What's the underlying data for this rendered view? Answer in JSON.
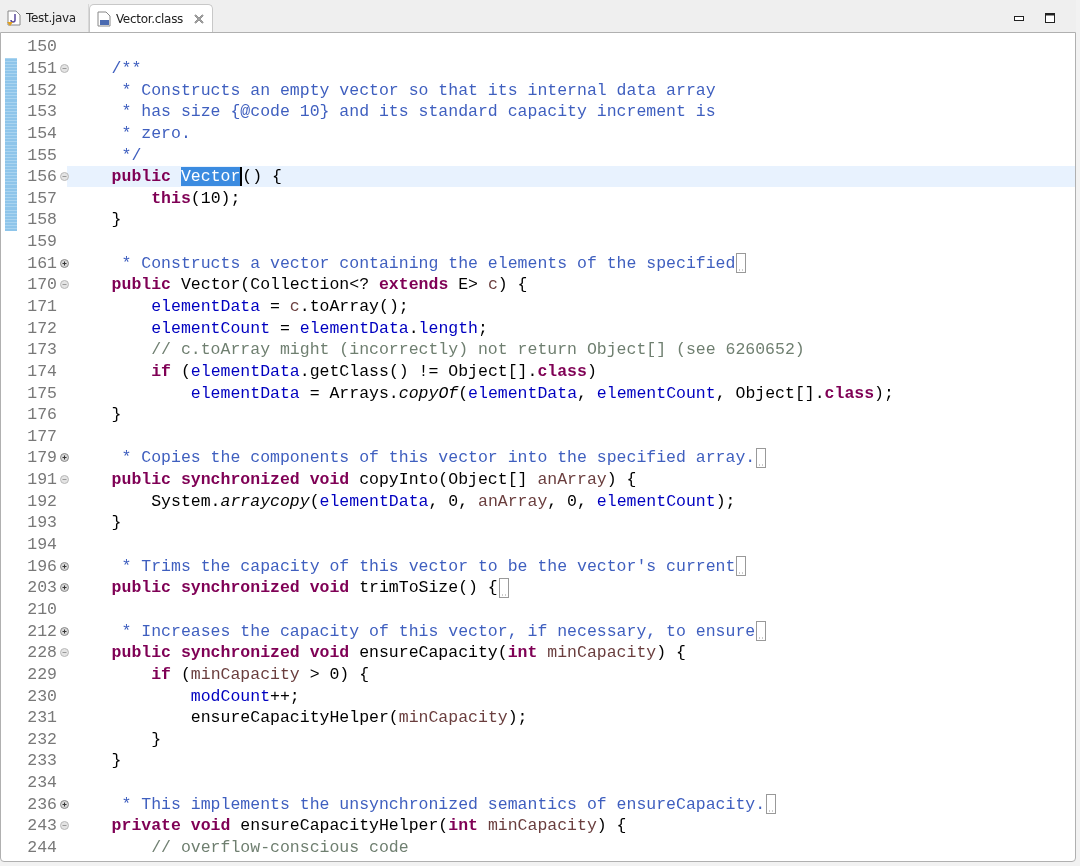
{
  "tabs": [
    {
      "label": "Test.java",
      "kind": "java",
      "selected": false
    },
    {
      "label": "Vector.class",
      "kind": "class",
      "selected": true
    }
  ],
  "lines": [
    {
      "number": "150",
      "changed": false,
      "current": false
    },
    {
      "number": "151",
      "folded": false,
      "changed": true,
      "current": false,
      "tokens": [
        {
          "kind": "javadoc",
          "text": "    /**"
        }
      ]
    },
    {
      "number": "152",
      "changed": true,
      "current": false,
      "tokens": [
        {
          "kind": "javadoc",
          "text": "     * Constructs an empty vector so that its internal data array"
        }
      ]
    },
    {
      "number": "153",
      "changed": true,
      "current": false,
      "tokens": [
        {
          "kind": "javadoc",
          "text": "     * has size {@code 10} and its standard capacity increment is"
        }
      ]
    },
    {
      "number": "154",
      "changed": true,
      "current": false,
      "tokens": [
        {
          "kind": "javadoc",
          "text": "     * zero."
        }
      ]
    },
    {
      "number": "155",
      "changed": true,
      "current": false,
      "tokens": [
        {
          "kind": "javadoc",
          "text": "     */"
        }
      ]
    },
    {
      "number": "156",
      "folded": false,
      "changed": true,
      "current": true,
      "tokens": [
        {
          "kind": "keyword",
          "text": "    public "
        },
        {
          "kind": "selected",
          "text": "Vector"
        },
        {
          "kind": "plain",
          "text": "() {"
        }
      ]
    },
    {
      "number": "157",
      "changed": true,
      "current": false,
      "tokens": [
        {
          "kind": "keyword",
          "text": "        this"
        },
        {
          "kind": "plain",
          "text": "(10);"
        }
      ]
    },
    {
      "number": "158",
      "changed": true,
      "current": false,
      "tokens": [
        {
          "kind": "plain",
          "text": "    }"
        }
      ]
    },
    {
      "number": "159",
      "changed": false,
      "current": false
    },
    {
      "number": "161",
      "folded": true,
      "changed": false,
      "current": false,
      "tokens": [
        {
          "kind": "javadoc",
          "text": "     * Constructs a vector containing the elements of the specified"
        }
      ]
    },
    {
      "number": "170",
      "folded": false,
      "changed": false,
      "current": false,
      "tokens": [
        {
          "kind": "keyword",
          "text": "    public"
        },
        {
          "kind": "plain",
          "text": " Vector(Collection<? "
        },
        {
          "kind": "keyword",
          "text": "extends"
        },
        {
          "kind": "plain",
          "text": " E> "
        },
        {
          "kind": "param",
          "text": "c"
        },
        {
          "kind": "plain",
          "text": ") {"
        }
      ]
    },
    {
      "number": "171",
      "changed": false,
      "current": false,
      "tokens": [
        {
          "kind": "field",
          "text": "        elementData"
        },
        {
          "kind": "plain",
          "text": " = "
        },
        {
          "kind": "param",
          "text": "c"
        },
        {
          "kind": "plain",
          "text": ".toArray();"
        }
      ]
    },
    {
      "number": "172",
      "changed": false,
      "current": false,
      "tokens": [
        {
          "kind": "field",
          "text": "        elementCount"
        },
        {
          "kind": "plain",
          "text": " = "
        },
        {
          "kind": "field",
          "text": "elementData"
        },
        {
          "kind": "plain",
          "text": "."
        },
        {
          "kind": "field",
          "text": "length"
        },
        {
          "kind": "plain",
          "text": ";"
        }
      ]
    },
    {
      "number": "173",
      "changed": false,
      "current": false,
      "tokens": [
        {
          "kind": "comment",
          "text": "        // c.toArray might (incorrectly) not return Object[] (see 6260652)"
        }
      ]
    },
    {
      "number": "174",
      "changed": false,
      "current": false,
      "tokens": [
        {
          "kind": "keyword",
          "text": "        if"
        },
        {
          "kind": "plain",
          "text": " ("
        },
        {
          "kind": "field",
          "text": "elementData"
        },
        {
          "kind": "plain",
          "text": ".getClass() != Object[]."
        },
        {
          "kind": "keyword",
          "text": "class"
        },
        {
          "kind": "plain",
          "text": ")"
        }
      ]
    },
    {
      "number": "175",
      "changed": false,
      "current": false,
      "tokens": [
        {
          "kind": "field",
          "text": "            elementData"
        },
        {
          "kind": "plain",
          "text": " = Arrays."
        },
        {
          "kind": "static",
          "text": "copyOf"
        },
        {
          "kind": "plain",
          "text": "("
        },
        {
          "kind": "field",
          "text": "elementData"
        },
        {
          "kind": "plain",
          "text": ", "
        },
        {
          "kind": "field",
          "text": "elementCount"
        },
        {
          "kind": "plain",
          "text": ", Object[]."
        },
        {
          "kind": "keyword",
          "text": "class"
        },
        {
          "kind": "plain",
          "text": ");"
        }
      ]
    },
    {
      "number": "176",
      "changed": false,
      "current": false,
      "tokens": [
        {
          "kind": "plain",
          "text": "    }"
        }
      ]
    },
    {
      "number": "177",
      "changed": false,
      "current": false
    },
    {
      "number": "179",
      "folded": true,
      "changed": false,
      "current": false,
      "tokens": [
        {
          "kind": "javadoc",
          "text": "     * Copies the components of this vector into the specified array."
        }
      ]
    },
    {
      "number": "191",
      "folded": false,
      "changed": false,
      "current": false,
      "tokens": [
        {
          "kind": "keyword",
          "text": "    public synchronized void"
        },
        {
          "kind": "plain",
          "text": " copyInto(Object[] "
        },
        {
          "kind": "param",
          "text": "anArray"
        },
        {
          "kind": "plain",
          "text": ") {"
        }
      ]
    },
    {
      "number": "192",
      "changed": false,
      "current": false,
      "tokens": [
        {
          "kind": "plain",
          "text": "        System."
        },
        {
          "kind": "static",
          "text": "arraycopy"
        },
        {
          "kind": "plain",
          "text": "("
        },
        {
          "kind": "field",
          "text": "elementData"
        },
        {
          "kind": "plain",
          "text": ", 0, "
        },
        {
          "kind": "param",
          "text": "anArray"
        },
        {
          "kind": "plain",
          "text": ", 0, "
        },
        {
          "kind": "field",
          "text": "elementCount"
        },
        {
          "kind": "plain",
          "text": ");"
        }
      ]
    },
    {
      "number": "193",
      "changed": false,
      "current": false,
      "tokens": [
        {
          "kind": "plain",
          "text": "    }"
        }
      ]
    },
    {
      "number": "194",
      "changed": false,
      "current": false
    },
    {
      "number": "196",
      "folded": true,
      "changed": false,
      "current": false,
      "tokens": [
        {
          "kind": "javadoc",
          "text": "     * Trims the capacity of this vector to be the vector's current"
        }
      ]
    },
    {
      "number": "203",
      "folded": true,
      "changed": false,
      "current": false,
      "tokens": [
        {
          "kind": "keyword",
          "text": "    public synchronized void"
        },
        {
          "kind": "plain",
          "text": " trimToSize() {"
        }
      ]
    },
    {
      "number": "210",
      "changed": false,
      "current": false
    },
    {
      "number": "212",
      "folded": true,
      "changed": false,
      "current": false,
      "tokens": [
        {
          "kind": "javadoc",
          "text": "     * Increases the capacity of this vector, if necessary, to ensure"
        }
      ]
    },
    {
      "number": "228",
      "folded": false,
      "changed": false,
      "current": false,
      "tokens": [
        {
          "kind": "keyword",
          "text": "    public synchronized void"
        },
        {
          "kind": "plain",
          "text": " ensureCapacity("
        },
        {
          "kind": "keyword",
          "text": "int "
        },
        {
          "kind": "param",
          "text": "minCapacity"
        },
        {
          "kind": "plain",
          "text": ") {"
        }
      ]
    },
    {
      "number": "229",
      "changed": false,
      "current": false,
      "tokens": [
        {
          "kind": "keyword",
          "text": "        if"
        },
        {
          "kind": "plain",
          "text": " ("
        },
        {
          "kind": "param",
          "text": "minCapacity"
        },
        {
          "kind": "plain",
          "text": " > 0) {"
        }
      ]
    },
    {
      "number": "230",
      "changed": false,
      "current": false,
      "tokens": [
        {
          "kind": "field",
          "text": "            modCount"
        },
        {
          "kind": "plain",
          "text": "++;"
        }
      ]
    },
    {
      "number": "231",
      "changed": false,
      "current": false,
      "tokens": [
        {
          "kind": "plain",
          "text": "            ensureCapacityHelper("
        },
        {
          "kind": "param",
          "text": "minCapacity"
        },
        {
          "kind": "plain",
          "text": ");"
        }
      ]
    },
    {
      "number": "232",
      "changed": false,
      "current": false,
      "tokens": [
        {
          "kind": "plain",
          "text": "        }"
        }
      ]
    },
    {
      "number": "233",
      "changed": false,
      "current": false,
      "tokens": [
        {
          "kind": "plain",
          "text": "    }"
        }
      ]
    },
    {
      "number": "234",
      "changed": false,
      "current": false
    },
    {
      "number": "236",
      "folded": true,
      "changed": false,
      "current": false,
      "tokens": [
        {
          "kind": "javadoc",
          "text": "     * This implements the unsynchronized semantics of ensureCapacity."
        }
      ]
    },
    {
      "number": "243",
      "folded": false,
      "changed": false,
      "current": false,
      "tokens": [
        {
          "kind": "keyword",
          "text": "    private void"
        },
        {
          "kind": "plain",
          "text": " ensureCapacityHelper("
        },
        {
          "kind": "keyword",
          "text": "int "
        },
        {
          "kind": "param",
          "text": "minCapacity"
        },
        {
          "kind": "plain",
          "text": ") {"
        }
      ]
    },
    {
      "number": "244",
      "changed": false,
      "current": false,
      "tokens": [
        {
          "kind": "comment",
          "text": "        // overflow-conscious code"
        }
      ]
    }
  ]
}
